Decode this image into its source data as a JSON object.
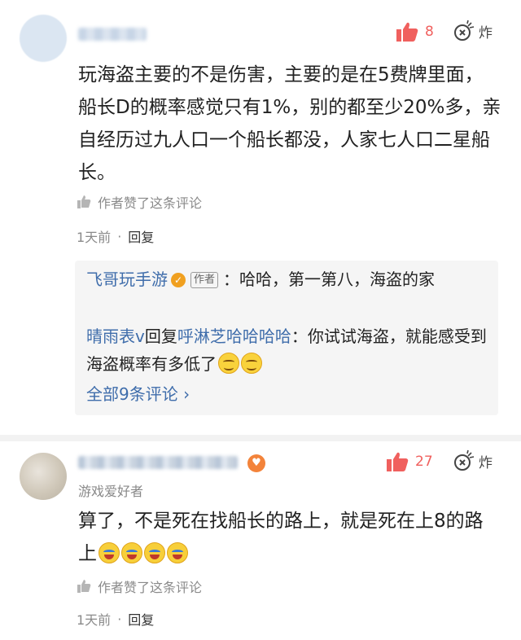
{
  "comment1": {
    "like_count": "8",
    "boom_label": "炸",
    "text": "玩海盗主要的不是伤害，主要的是在5费牌里面，船长D的概率感觉只有1%，别的都至少20%多，亲自经历过九人口一个船长都没，人家七人口二星船长。",
    "author_liked": "作者赞了这条评论",
    "time": "1天前",
    "dot": "·",
    "reply_label": "回复",
    "replies": {
      "r1_user": "飞哥玩手游",
      "r1_tag": "作者",
      "r1_sep": "：",
      "r1_text": "哈哈，第一第八，海盗的家",
      "r2_user": "晴雨表v",
      "r2_mid": "回复",
      "r2_target": "呼淋芝哈哈哈哈",
      "r2_sep": "：",
      "r2_text": "你试试海盗，就能感受到海盗概率有多低了",
      "all_link": "全部9条评论 ›"
    }
  },
  "comment2": {
    "like_count": "27",
    "boom_label": "炸",
    "user_tag": "游戏爱好者",
    "text": "算了，不是死在找船长的路上，就是死在上8的路上",
    "author_liked": "作者赞了这条评论",
    "time": "1天前",
    "dot": "·",
    "reply_label": "回复"
  },
  "colors": {
    "accent_red": "#f0605e",
    "link_blue": "#3f6dab"
  },
  "icons": [
    "thumb-up-icon",
    "boom-icon",
    "thumb-small-icon",
    "verified-icon",
    "grin-emoji",
    "laugh-cry-emoji",
    "medal-icon"
  ]
}
